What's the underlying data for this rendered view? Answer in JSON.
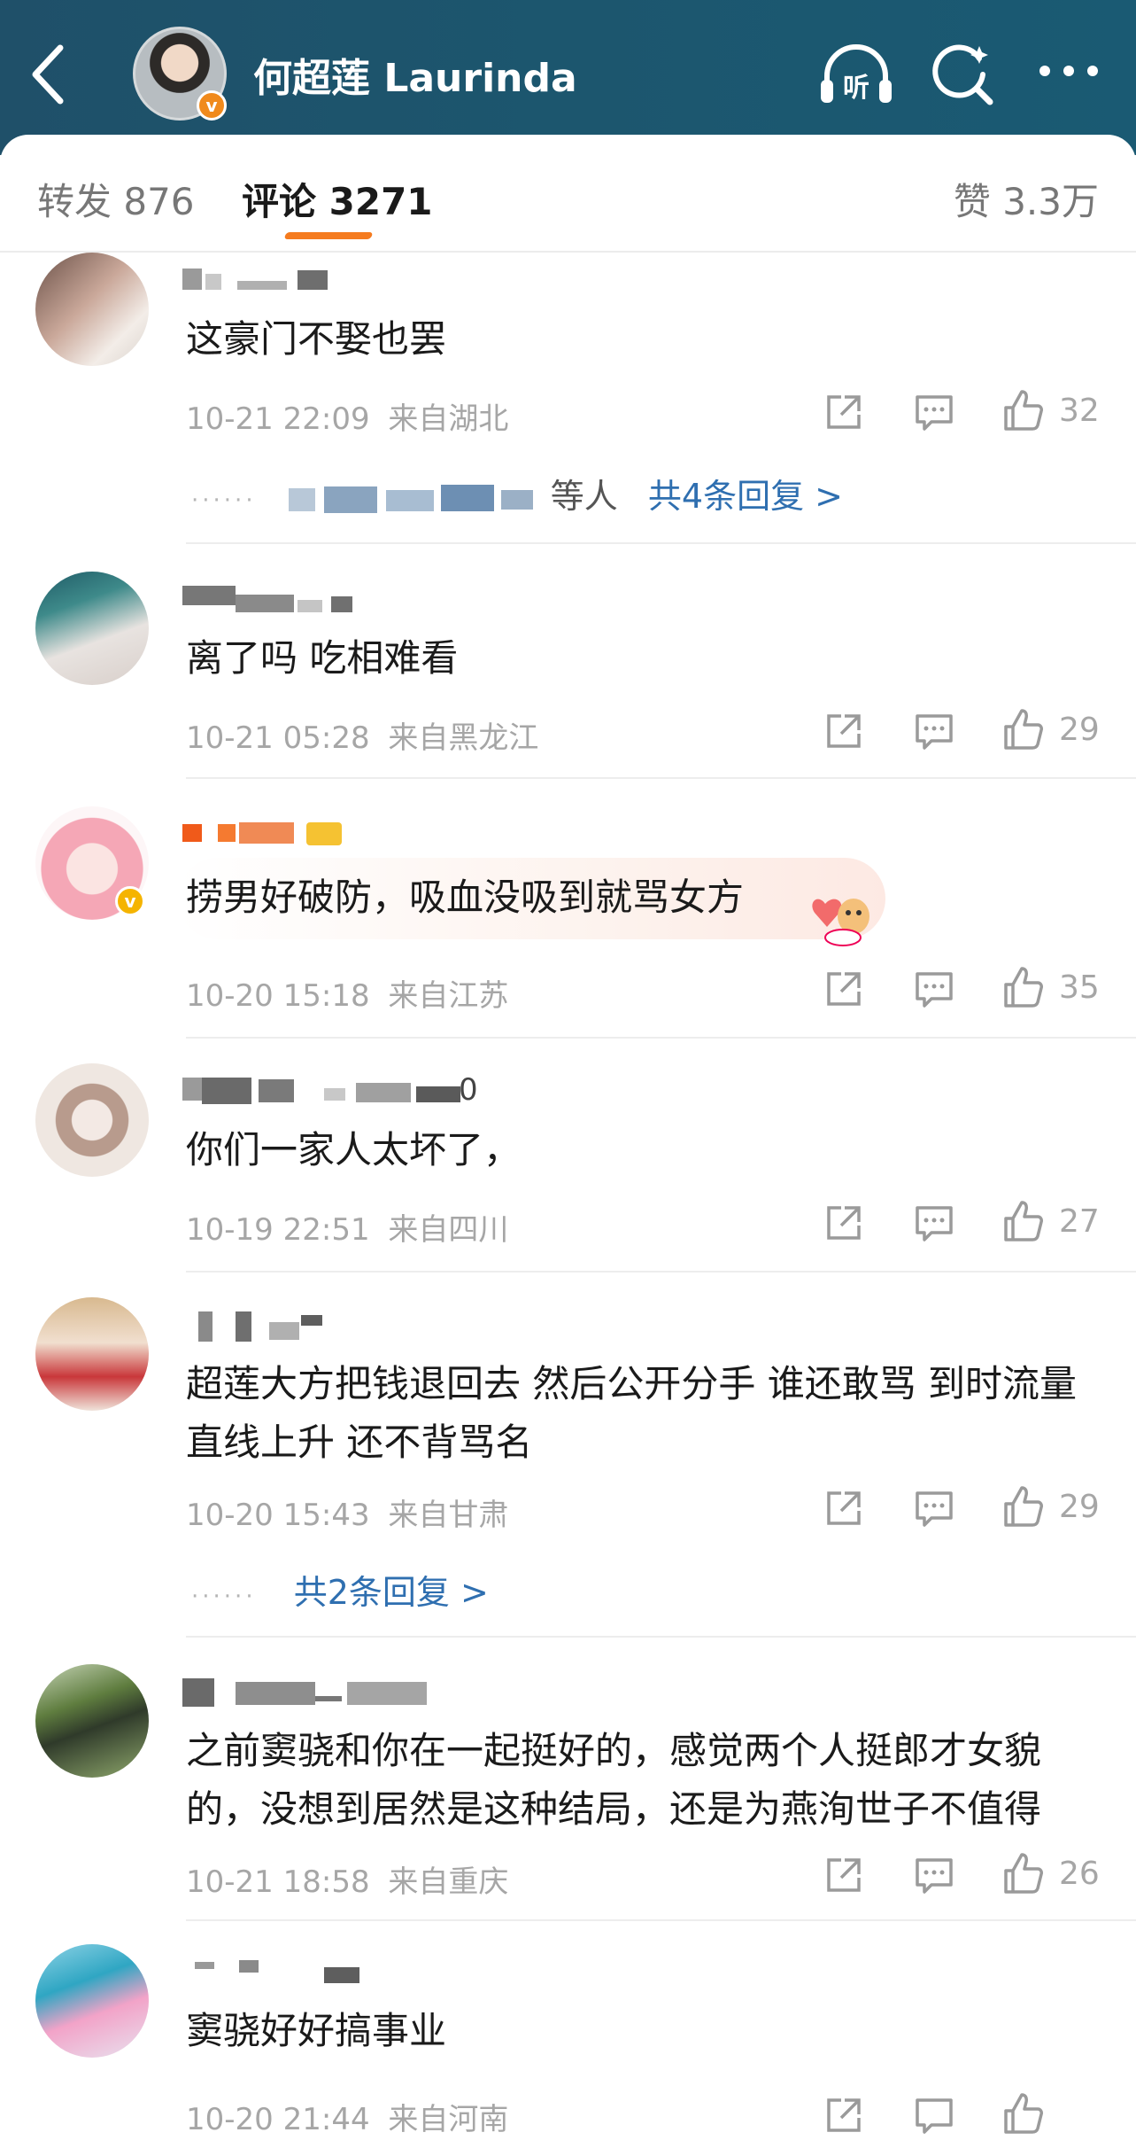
{
  "header": {
    "title": "何超莲 Laurinda",
    "verified_badge": "v",
    "back_icon": "back-arrow-icon",
    "listen_label": "听",
    "bg_color": "#1c566e"
  },
  "tabs": {
    "repost": "转发 876",
    "comments": "评论 3271",
    "likes": "赞 3.3万",
    "accent_color": "#f57b1f"
  },
  "comments": [
    {
      "text": "这豪门不娶也罢",
      "time": "10-21 22:09",
      "location": "来自湖北",
      "likes": "32",
      "reply_prefix": "······",
      "reply_partial": "等人",
      "reply_link": "共4条回复 >"
    },
    {
      "text": "离了吗 吃相难看",
      "time": "10-21 05:28",
      "location": "来自黑龙江",
      "likes": "29"
    },
    {
      "text": "捞男好破防，吸血没吸到就骂女方",
      "time": "10-20 15:18",
      "location": "来自江苏",
      "likes": "35",
      "verified_badge": "v"
    },
    {
      "name_suffix": "0",
      "text": "你们一家人太坏了，",
      "time": "10-19 22:51",
      "location": "来自四川",
      "likes": "27"
    },
    {
      "text": "超莲大方把钱退回去 然后公开分手 谁还敢骂 到时流量直线上升 还不背骂名",
      "time": "10-20 15:43",
      "location": "来自甘肃",
      "likes": "29",
      "reply_prefix": "······",
      "reply_link": "共2条回复 >"
    },
    {
      "text": "之前窦骁和你在一起挺好的，感觉两个人挺郎才女貌的，没想到居然是这种结局，还是为燕洵世子不值得",
      "time": "10-21 18:58",
      "location": "来自重庆",
      "likes": "26"
    },
    {
      "text": "窦骁好好搞事业",
      "time": "10-20 21:44",
      "location": "来自河南",
      "likes": ""
    }
  ],
  "colors": {
    "link": "#2f6fb0",
    "meta": "#a6a6a6",
    "badge": "#f08a1c"
  }
}
